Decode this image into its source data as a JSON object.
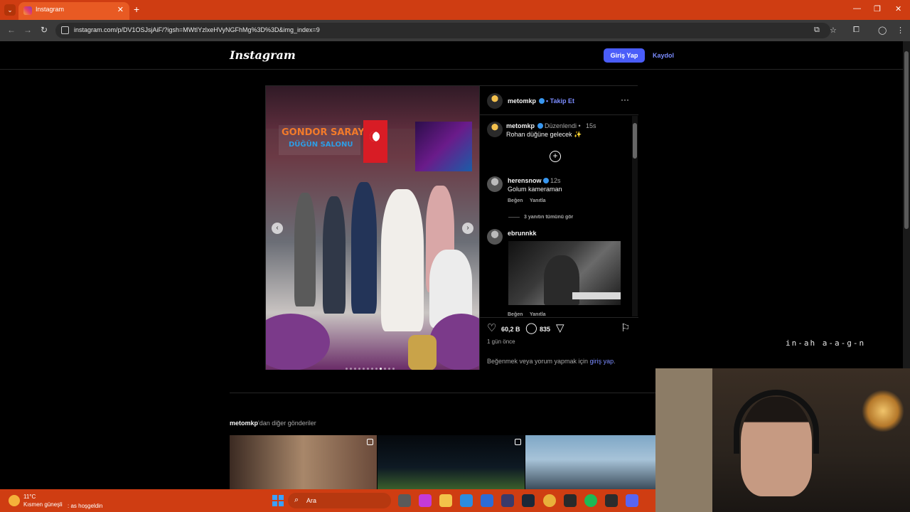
{
  "browser": {
    "tab_title": "Instagram",
    "url": "instagram.com/p/DV1OSJsjAiF/?igsh=MWtIYzlxeHVyNGFhMg%3D%3D&img_index=9"
  },
  "ig": {
    "logo": "Instagram",
    "login_label": "Giriş Yap",
    "signup_label": "Kaydol"
  },
  "post": {
    "photo_sign_line1": "GONDOR SARAY",
    "photo_sign_line2": "DÜĞÜN SALONU",
    "carousel_dots": 12,
    "carousel_active": 9,
    "header_user": "metomkp",
    "follow_label": "• Takip Et",
    "caption_user": "metomkp",
    "caption_edited": "Düzenlendi •",
    "caption_time": "15s",
    "caption_text": "Rohan düğüne gelecek ✨",
    "comments": [
      {
        "user": "herensnow",
        "time": "12s",
        "text": "Golum kameraman",
        "like": "Beğen",
        "reply": "Yanıtla",
        "view_replies": "3 yanıtın tümünü gör"
      },
      {
        "user": "ebrunnkk",
        "like": "Beğen",
        "reply": "Yanıtla"
      }
    ],
    "likes": "60,2 B",
    "comments_count": "835",
    "time_ago": "1 gün önce",
    "login_prompt_prefix": "Beğenmek veya yorum yapmak için ",
    "login_prompt_link": "giriş yap",
    "login_prompt_suffix": "."
  },
  "more": {
    "user": "metomkp",
    "suffix": "'dan diğer gönderiler"
  },
  "overlay": {
    "handwriting": "in-ah a-a-g-n"
  },
  "taskbar": {
    "temperature": "11°C",
    "weather": "Kısmen güneşli",
    "ticker": ": as hoşgeldin",
    "search_placeholder": "Ara"
  },
  "colors": {
    "tab_strip": "#cf3d12",
    "ig_blue_button": "#4a5df9",
    "link_blue": "#7b8cff",
    "verified": "#3897f0"
  }
}
